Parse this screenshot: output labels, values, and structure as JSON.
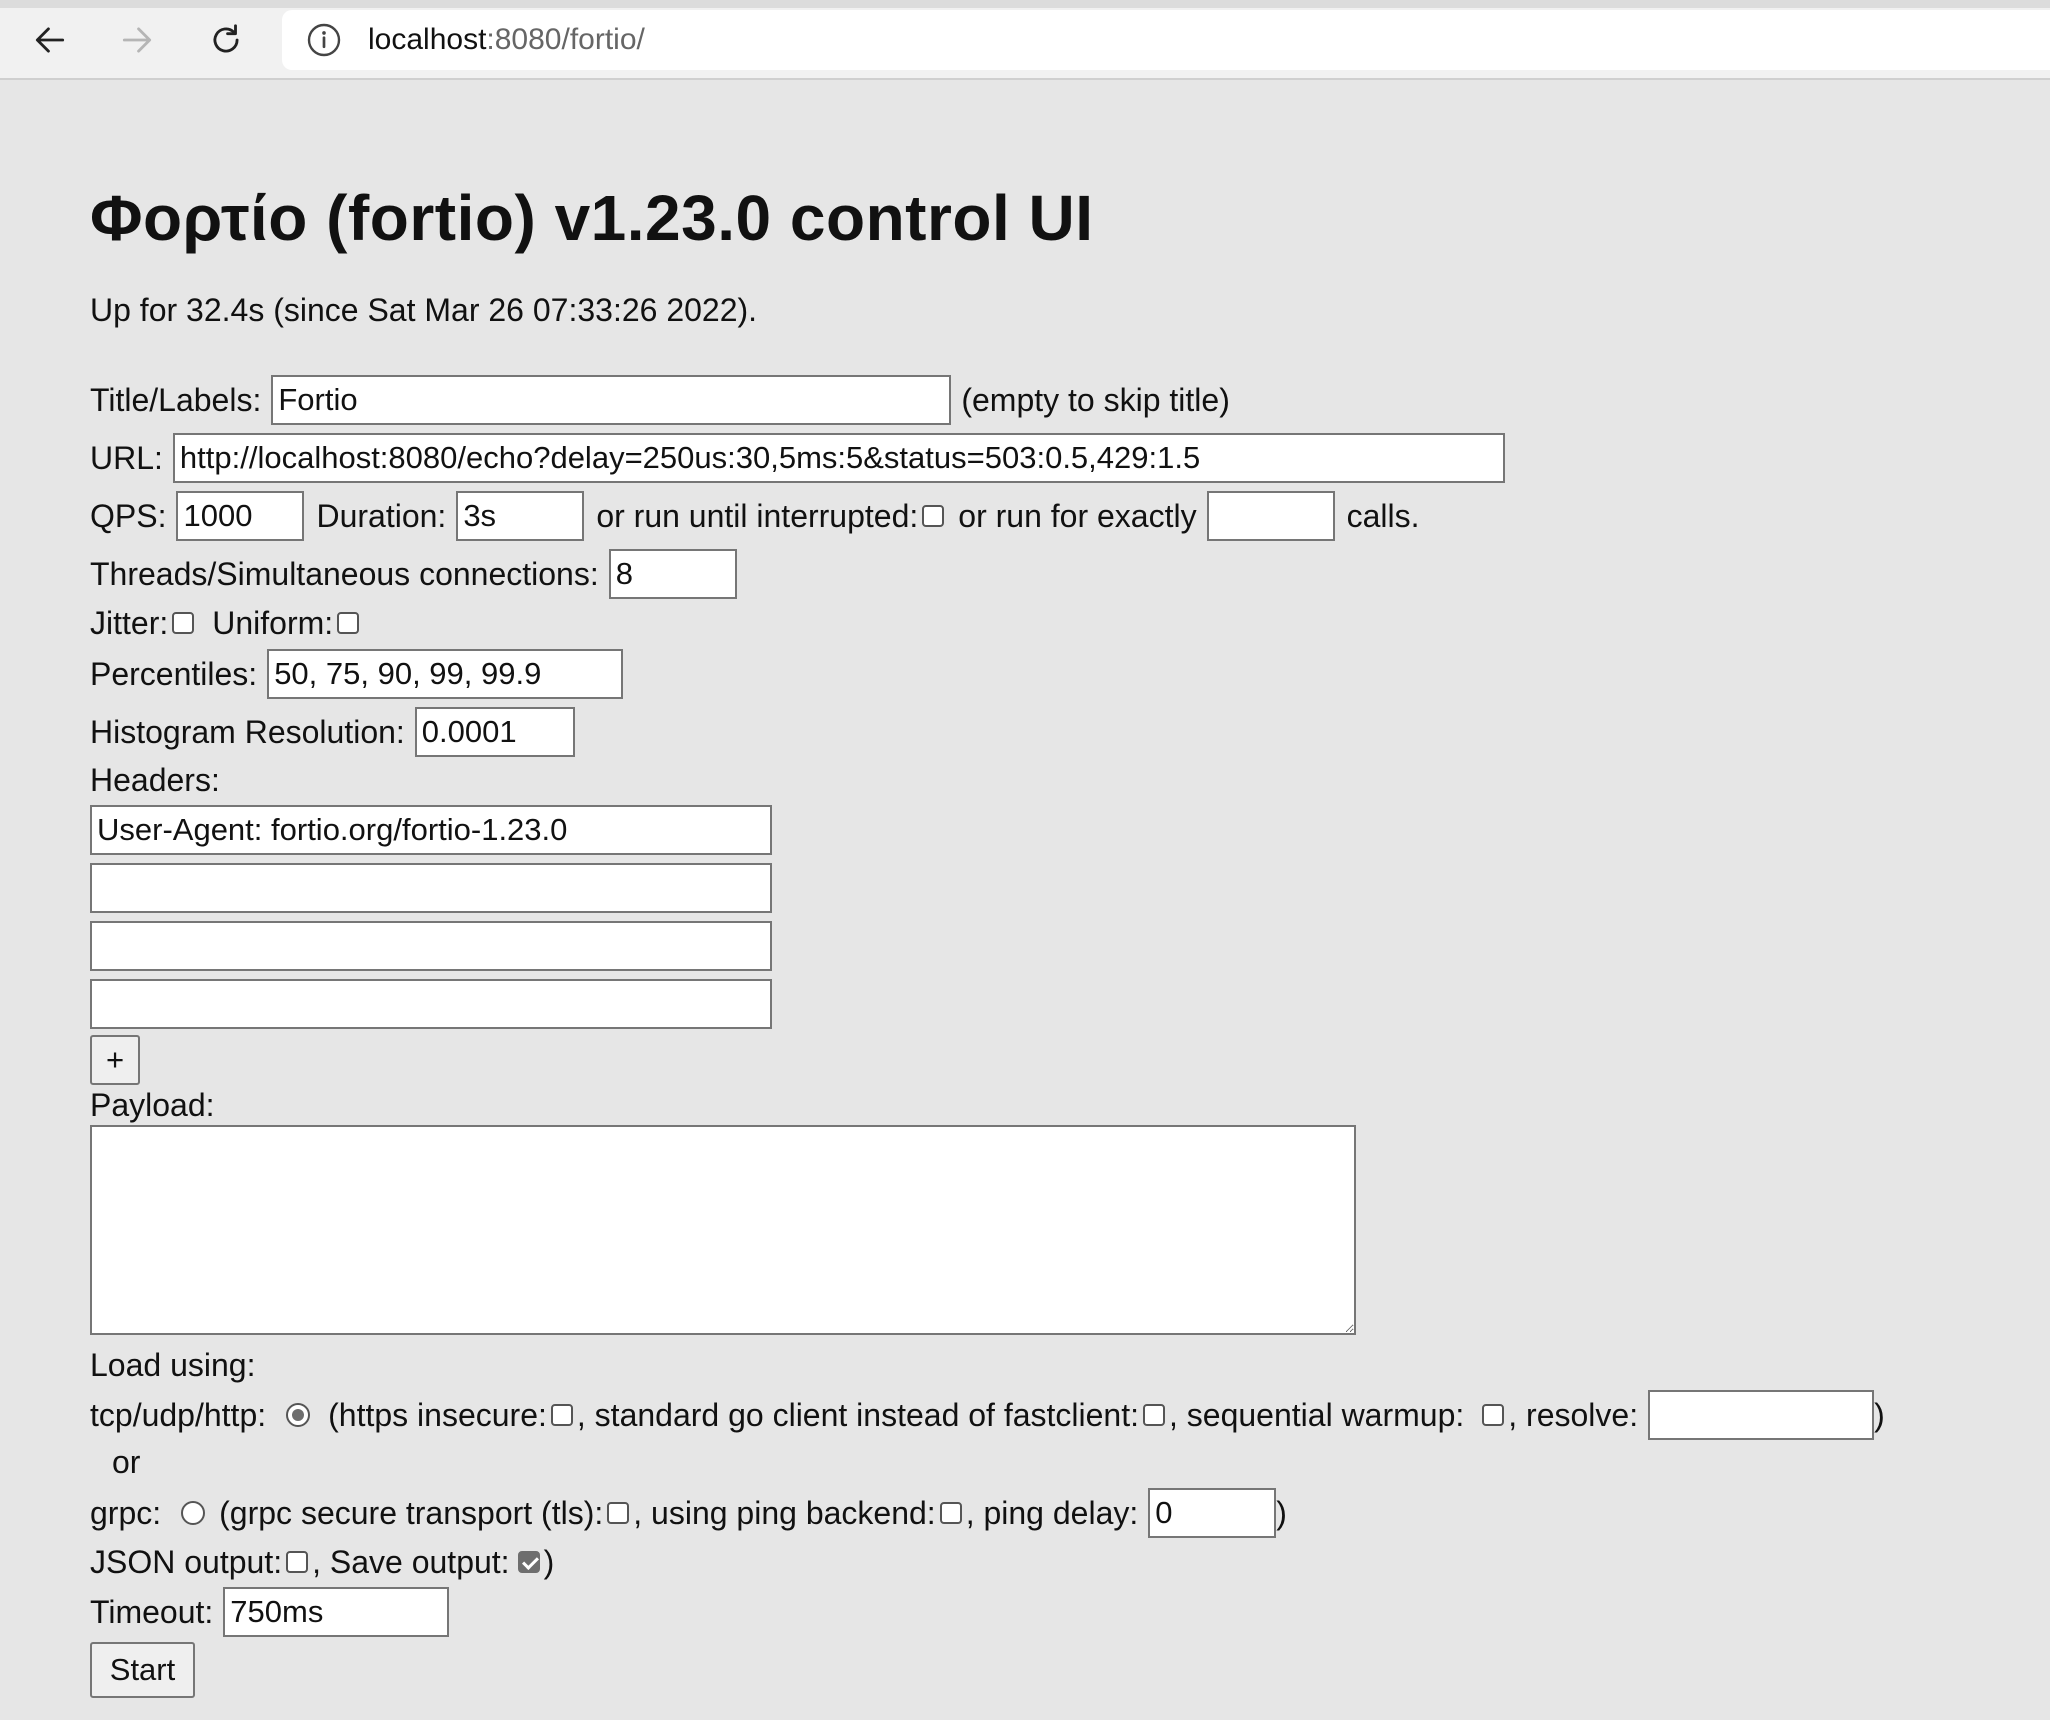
{
  "browser": {
    "url_host": "localhost",
    "url_path": ":8080/fortio/"
  },
  "page": {
    "title": "Φορτίο (fortio) v1.23.0 control UI",
    "uptime": "Up for 32.4s (since Sat Mar 26 07:33:26 2022)."
  },
  "form": {
    "title_label": "Title/Labels:",
    "title_value": "Fortio",
    "title_hint": "(empty to skip title)",
    "url_label": "URL:",
    "url_value": "http://localhost:8080/echo?delay=250us:30,5ms:5&status=503:0.5,429:1.5",
    "qps_label": "QPS:",
    "qps_value": "1000",
    "duration_label": "Duration:",
    "duration_value": "3s",
    "until_interrupted_label": "or run until interrupted:",
    "exactly_label": "or run for exactly",
    "exactly_value": "",
    "calls_label": "calls.",
    "threads_label": "Threads/Simultaneous connections:",
    "threads_value": "8",
    "jitter_label": "Jitter:",
    "uniform_label": "Uniform:",
    "percentiles_label": "Percentiles:",
    "percentiles_value": "50, 75, 90, 99, 99.9",
    "histogram_label": "Histogram Resolution:",
    "histogram_value": "0.0001",
    "headers_label": "Headers:",
    "headers": [
      "User-Agent: fortio.org/fortio-1.23.0",
      "",
      "",
      ""
    ],
    "add_header_label": "+",
    "payload_label": "Payload:",
    "payload_value": "",
    "load_using_label": "Load using:",
    "http_label": "tcp/udp/http:",
    "https_insecure_label": "(https insecure:",
    "stdclient_label": ", standard go client instead of fastclient:",
    "warmup_label": ", sequential warmup:",
    "resolve_label": ", resolve:",
    "resolve_value": "",
    "close_paren": ")",
    "or_label": "or",
    "grpc_label": "grpc:",
    "grpc_tls_label": "(grpc secure transport (tls):",
    "ping_backend_label": ", using ping backend:",
    "ping_delay_label": ", ping delay:",
    "ping_delay_value": "0",
    "json_output_label": "JSON output:",
    "save_output_label": ", Save output:",
    "timeout_label": "Timeout:",
    "timeout_value": "750ms",
    "start_label": "Start"
  }
}
